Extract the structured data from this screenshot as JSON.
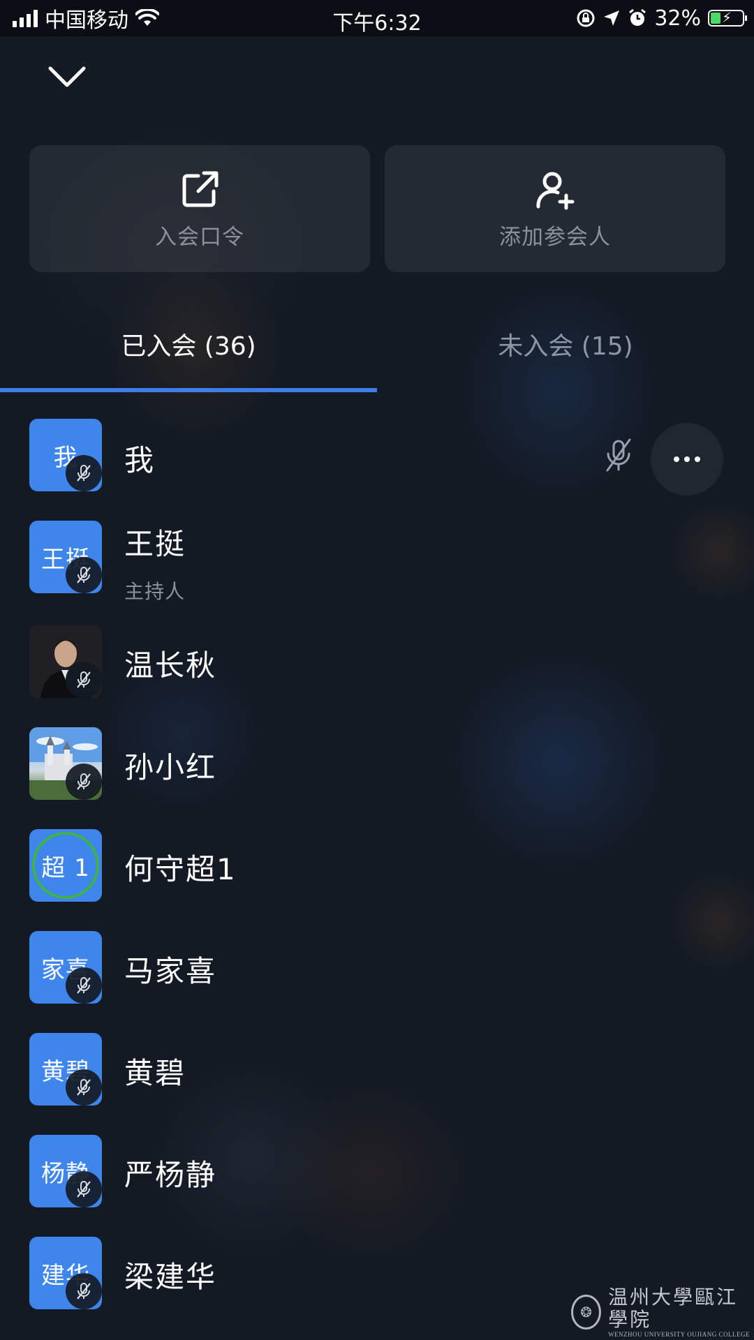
{
  "status_bar": {
    "carrier": "中国移动",
    "time": "下午6:32",
    "battery_percent": "32%"
  },
  "actions": {
    "passcode_label": "入会口令",
    "add_participant_label": "添加参会人"
  },
  "tabs": {
    "joined": "已入会 (36)",
    "not_joined": "未入会 (15)"
  },
  "participants": [
    {
      "avatar_text": "我",
      "name": "我",
      "role": ""
    },
    {
      "avatar_text": "王挺",
      "name": "王挺",
      "role": "主持人"
    },
    {
      "avatar_text": "",
      "name": "温长秋",
      "role": ""
    },
    {
      "avatar_text": "",
      "name": "孙小红",
      "role": ""
    },
    {
      "avatar_text": "超 1",
      "name": "何守超1",
      "role": ""
    },
    {
      "avatar_text": "家喜",
      "name": "马家喜",
      "role": ""
    },
    {
      "avatar_text": "黄碧",
      "name": "黄碧",
      "role": ""
    },
    {
      "avatar_text": "杨静",
      "name": "严杨静",
      "role": ""
    },
    {
      "avatar_text": "建华",
      "name": "梁建华",
      "role": ""
    }
  ],
  "watermark": {
    "chinese": "温州大學甌江學院",
    "english": "WENZHOU UNIVERSITY OUJIANG COLLEGE"
  },
  "colors": {
    "background": "#141a24",
    "accent": "#3f7ee8",
    "avatar_blue": "#3f86ec",
    "speaking_ring": "#3fb24a",
    "muted_text": "#8a929f"
  }
}
